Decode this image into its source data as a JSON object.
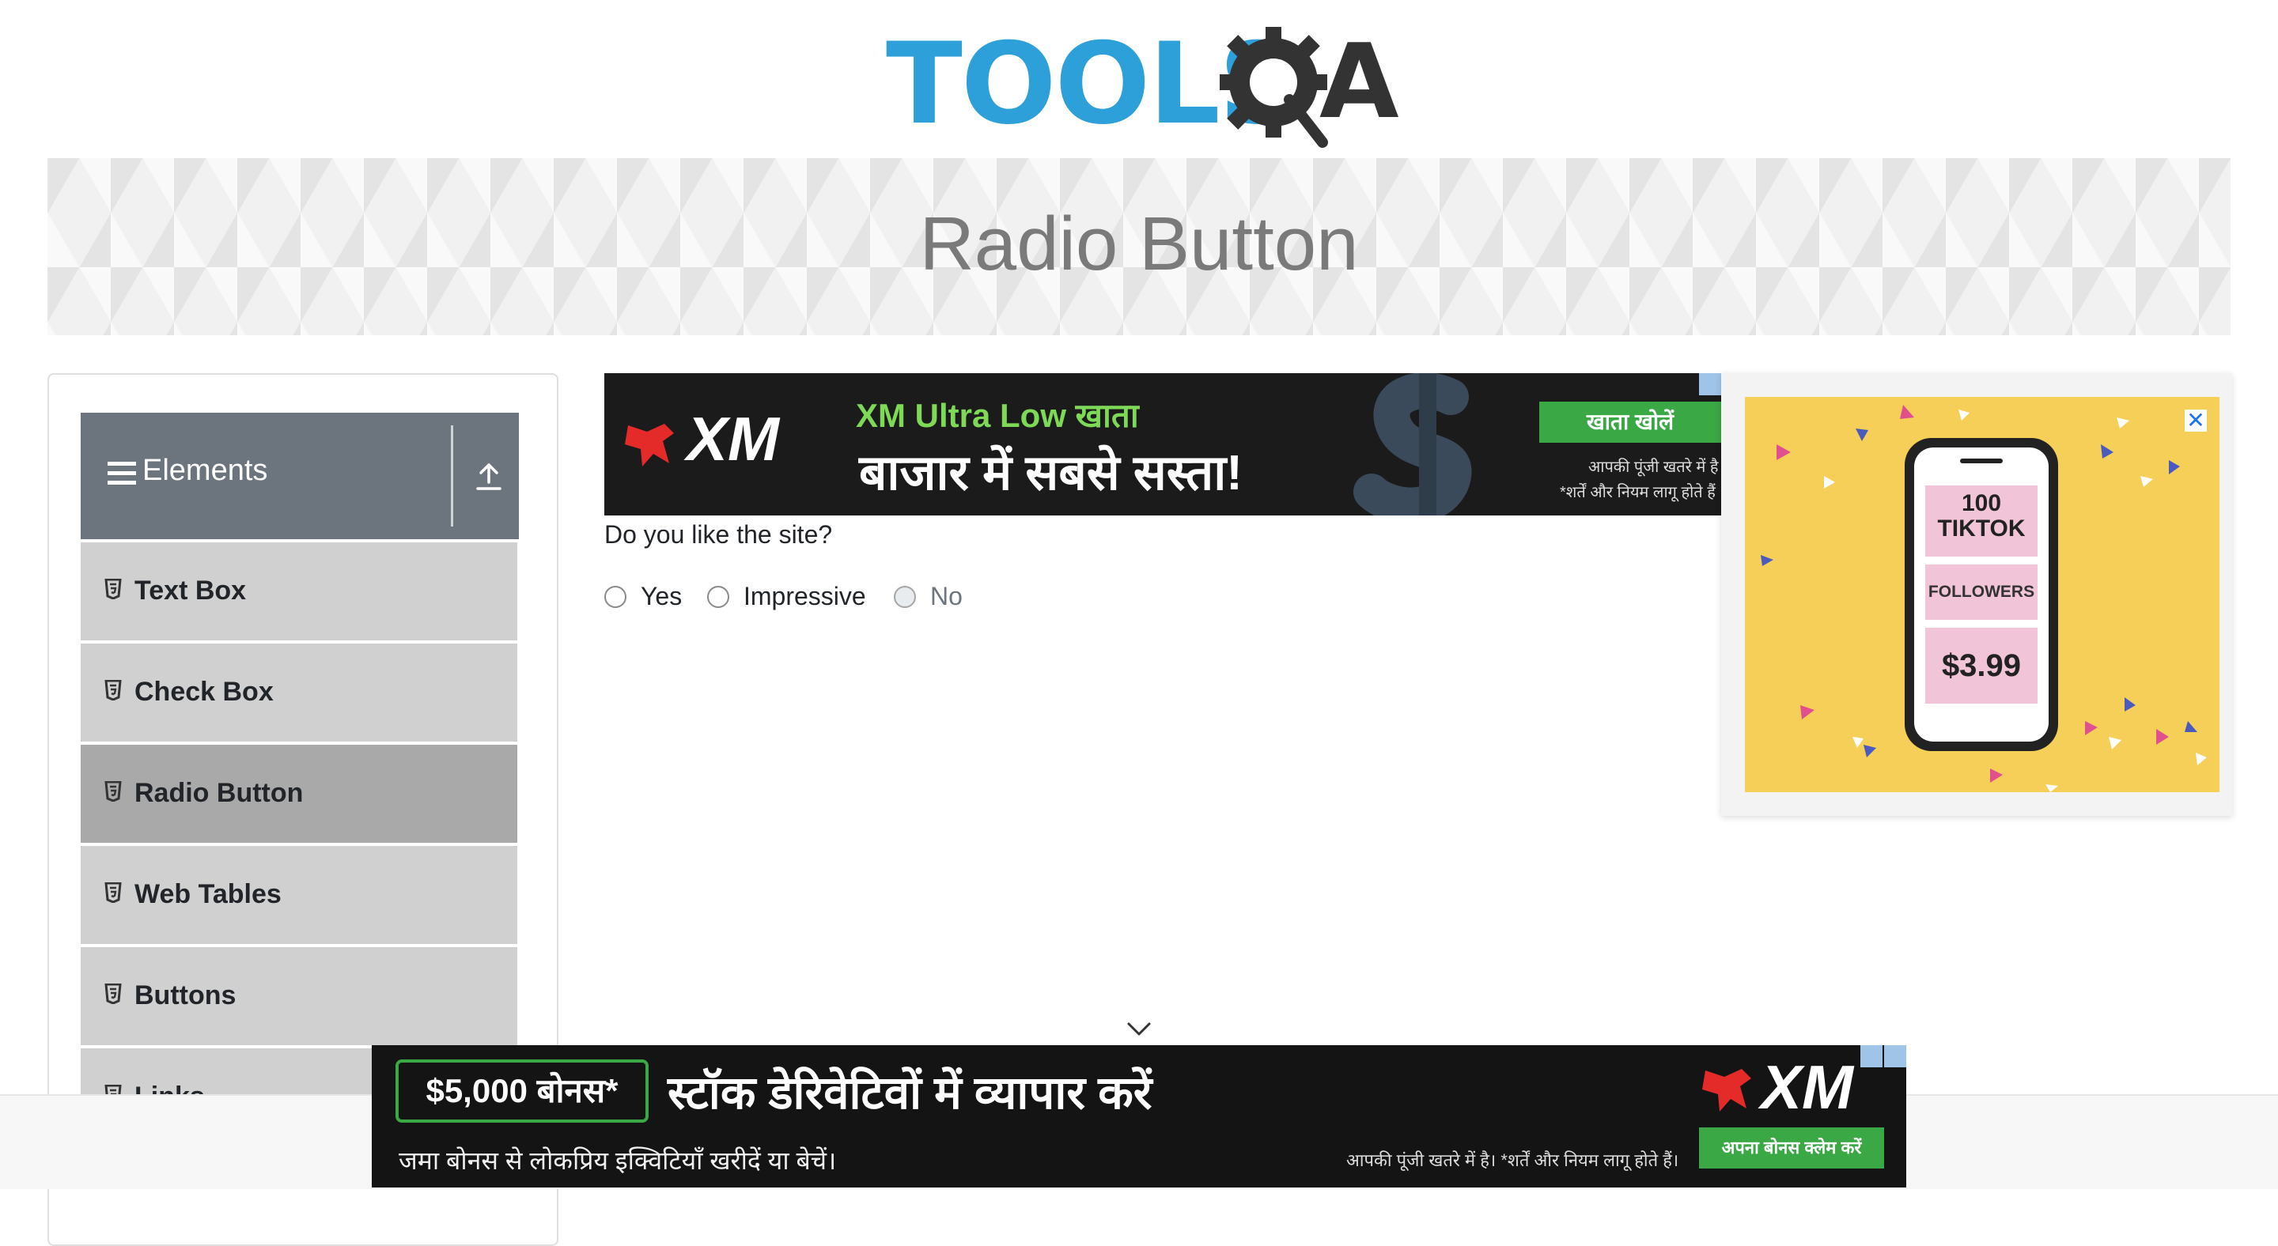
{
  "logo": {
    "text": "TOOLS",
    "suffix": "A"
  },
  "banner": {
    "title": "Radio Button"
  },
  "sidebar": {
    "group_label": "Elements",
    "items": [
      {
        "label": "Text Box",
        "active": false
      },
      {
        "label": "Check Box",
        "active": false
      },
      {
        "label": "Radio Button",
        "active": true
      },
      {
        "label": "Web Tables",
        "active": false
      },
      {
        "label": "Buttons",
        "active": false
      },
      {
        "label": "Links",
        "active": false
      }
    ]
  },
  "main": {
    "question": "Do you like the site?",
    "options": [
      {
        "label": "Yes",
        "disabled": false
      },
      {
        "label": "Impressive",
        "disabled": false
      },
      {
        "label": "No",
        "disabled": true
      }
    ]
  },
  "ads": {
    "top": {
      "brand": "XM",
      "headline": "XM Ultra Low खाता",
      "subheadline": "बाजार में सबसे सस्ता!",
      "cta": "खाता खोलें",
      "disclaimer_1": "आपकी पूंजी खतरे में है",
      "disclaimer_2": "*शर्तें और नियम लागू होते हैं"
    },
    "side": {
      "line1": "100",
      "line2": "TIKTOK",
      "line3": "FOLLOWERS",
      "price": "$3.99",
      "close": "✕"
    },
    "bottom": {
      "badge": "$5,000 बोनस*",
      "headline": "स्टॉक डेरिवेटिवों में व्यापार करें",
      "sub": "जमा बोनस से लोकप्रिय इक्विटियाँ खरीदें या बेचें।",
      "disclaimer": "आपकी पूंजी खतरे में है। *शर्तें और नियम लागू होते हैं।",
      "cta": "अपना बोनस क्लेम करें",
      "brand": "XM"
    }
  },
  "colors": {
    "brand_blue": "#2d9fd9",
    "group_header": "#6c757d",
    "menu_bg": "#d0d0d0",
    "menu_active": "#a9a9a9",
    "ad_green": "#3aa845"
  }
}
